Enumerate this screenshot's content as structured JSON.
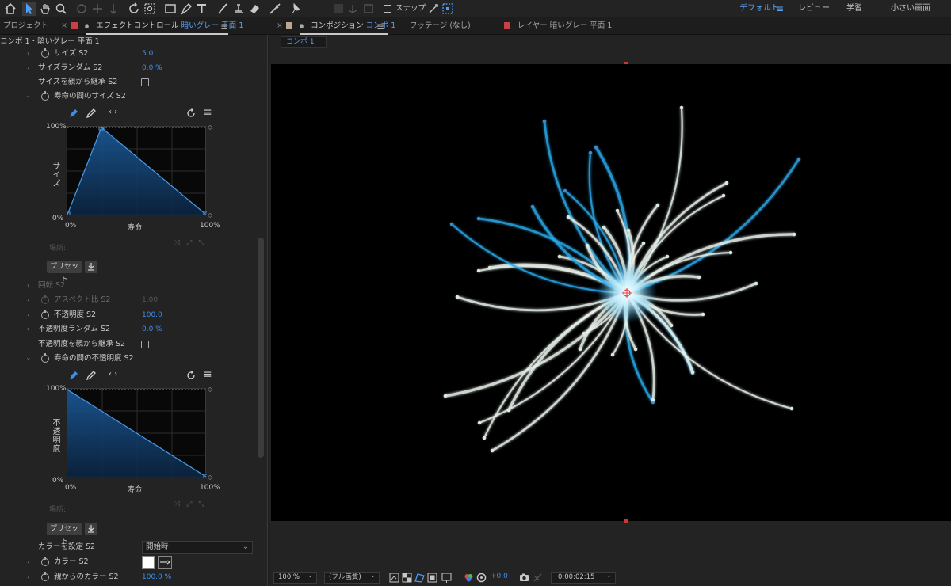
{
  "toolbar": {
    "snap_label": "スナップ",
    "workspaces": [
      "デフォルト",
      "レビュー",
      "学習",
      "小さい画面"
    ]
  },
  "left_panel": {
    "project_tab": "プロジェクト",
    "effect_tab_prefix": "エフェクトコントロール",
    "effect_tab_layer": "暗いグレー 平面 1",
    "breadcrumb": "コンポ 1・暗いグレー 平面 1",
    "rows": {
      "size": {
        "label": "サイズ S2",
        "value": "5.0"
      },
      "size_random": {
        "label": "サイズランダム S2",
        "value": "0.0 %"
      },
      "size_inherit": {
        "label": "サイズを親から継承 S2"
      },
      "size_over_life": {
        "label": "寿命の間のサイズ S2"
      },
      "rotation": {
        "label": "回転 S2"
      },
      "aspect": {
        "label": "アスペクト比 S2",
        "value": "1.00"
      },
      "opacity": {
        "label": "不透明度 S2",
        "value": "100.0"
      },
      "opacity_random": {
        "label": "不透明度ランダム S2",
        "value": "0.0 %"
      },
      "opacity_inherit": {
        "label": "不透明度を親から継承 S2"
      },
      "opacity_over_life": {
        "label": "寿命の間の不透明度 S2"
      },
      "set_color": {
        "label": "カラーを設定 S2",
        "value": "開始時"
      },
      "color": {
        "label": "カラー S2",
        "swatch": "#ffffff"
      },
      "color_from_parent": {
        "label": "親からのカラー S2",
        "value": "100.0 %"
      }
    },
    "graph_size": {
      "y_title": "サイズ",
      "y_top": "100%",
      "y_bottom": "0%",
      "x_left": "0%",
      "x_mid": "寿命",
      "x_right": "100%",
      "dim_label": "場所:",
      "preset_label": "プリセット"
    },
    "graph_opacity": {
      "y_title": "不透明度",
      "y_top": "100%",
      "y_bottom": "0%",
      "x_left": "0%",
      "x_mid": "寿命",
      "x_right": "100%",
      "dim_label": "場所:",
      "preset_label": "プリセット"
    }
  },
  "right_panel": {
    "comp_tab_prefix": "コンポジション",
    "comp_tab_name": "コンポ 1",
    "footage_tab": "フッテージ (なし)",
    "layer_tab": "レイヤー 暗いグレー 平面 1",
    "comp_pill": "コンポ 1",
    "bottom": {
      "zoom": "100 %",
      "resolution": "(フル画質)",
      "exposure": "+0.0",
      "timecode": "0:00:02:15"
    }
  },
  "colors": {
    "accent_blue": "#3d8fe8",
    "panel_bg": "#232323",
    "curve_fill": "#0f3a68",
    "particle_white": "#e8f2ea",
    "particle_cyan": "#2aa8e8",
    "marker_red": "#c83838"
  }
}
